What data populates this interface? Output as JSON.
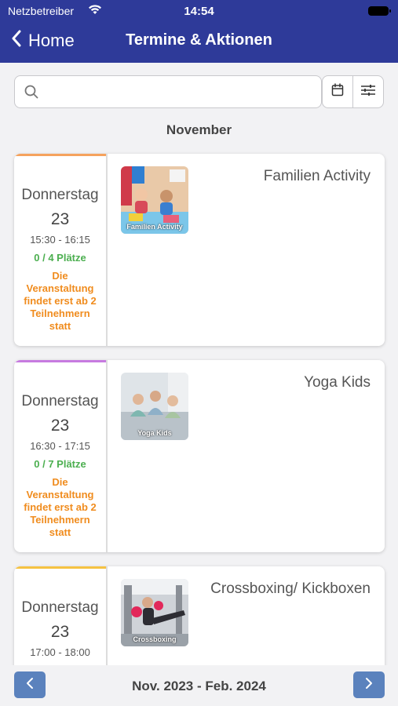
{
  "status_bar": {
    "carrier": "Netzbetreiber",
    "time": "14:54"
  },
  "nav": {
    "back_label": "Home",
    "title": "Termine & Aktionen"
  },
  "search": {
    "placeholder": ""
  },
  "month_header": "November",
  "events": [
    {
      "weekday": "Donnerstag",
      "day": "23",
      "time": "15:30 - 16:15",
      "places": "0 / 4 Plätze",
      "notice": "Die Veranstaltung findet erst ab 2 Teilnehmern statt",
      "title": "Familien Activity",
      "thumb_caption": "Familien Activity",
      "accent_color": "#f5a25d"
    },
    {
      "weekday": "Donnerstag",
      "day": "23",
      "time": "16:30 - 17:15",
      "places": "0 / 7 Plätze",
      "notice": "Die Veranstaltung findet erst ab 2 Teilnehmern statt",
      "title": "Yoga Kids",
      "thumb_caption": "Yoga Kids",
      "accent_color": "#c77be0"
    },
    {
      "weekday": "Donnerstag",
      "day": "23",
      "time": "17:00 - 18:00",
      "places": "",
      "notice": "",
      "title": "Crossboxing/ Kickboxen",
      "thumb_caption": "Crossboxing",
      "accent_color": "#f5c242"
    }
  ],
  "pager": {
    "range_label": "Nov. 2023 - Feb. 2024"
  },
  "colors": {
    "nav_bg": "#2e3a99",
    "pager_bg": "#5b82bd",
    "places_green": "#4caf50",
    "notice_orange": "#f08c1e"
  }
}
